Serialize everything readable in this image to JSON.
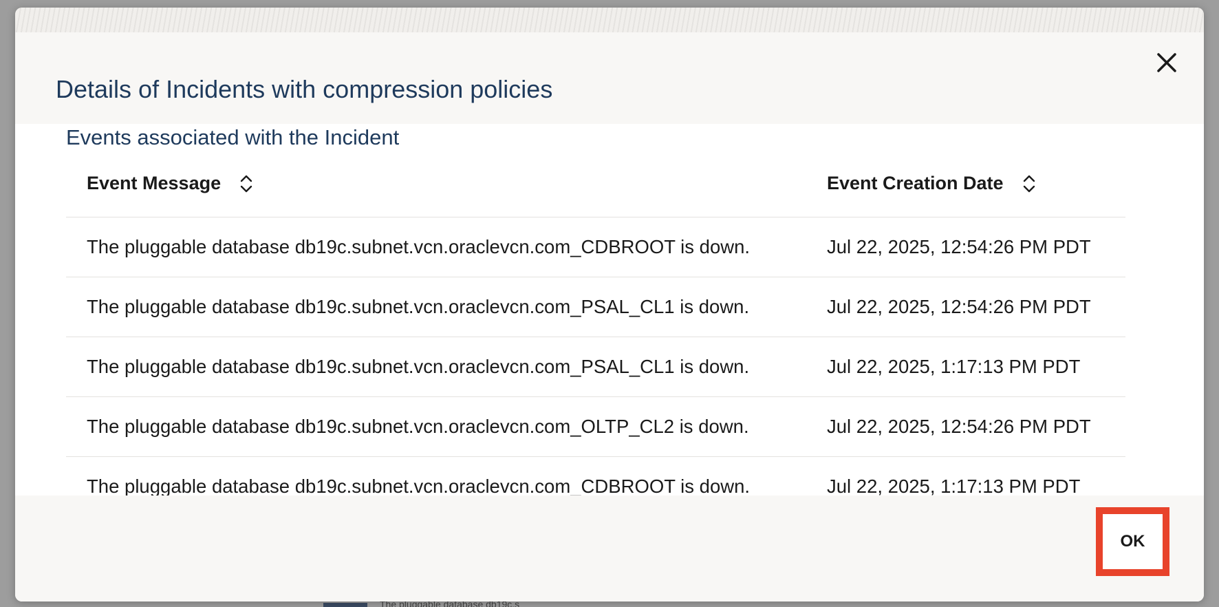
{
  "dialog": {
    "title": "Details of Incidents with compression policies",
    "close_icon": "close-icon",
    "ok_label": "OK"
  },
  "events": {
    "section_title": "Events associated with the Incident",
    "columns": [
      {
        "label": "Event Message",
        "sort_icon": "sort-updown-icon"
      },
      {
        "label": "Event Creation Date",
        "sort_icon": "sort-updown-icon"
      }
    ],
    "rows": [
      {
        "message": "The pluggable database db19c.subnet.vcn.oraclevcn.com_CDBROOT is down.",
        "date": "Jul 22, 2025, 12:54:26 PM PDT"
      },
      {
        "message": "The pluggable database db19c.subnet.vcn.oraclevcn.com_PSAL_CL1 is down.",
        "date": "Jul 22, 2025, 12:54:26 PM PDT"
      },
      {
        "message": "The pluggable database db19c.subnet.vcn.oraclevcn.com_PSAL_CL1 is down.",
        "date": "Jul 22, 2025, 1:17:13 PM PDT"
      },
      {
        "message": "The pluggable database db19c.subnet.vcn.oraclevcn.com_OLTP_CL2 is down.",
        "date": "Jul 22, 2025, 12:54:26 PM PDT"
      },
      {
        "message": "The pluggable database db19c.subnet.vcn.oraclevcn.com_CDBROOT is down.",
        "date": "Jul 22, 2025, 1:17:13 PM PDT"
      }
    ]
  },
  "background": {
    "peek_text": "The pluggable database db19c.s"
  },
  "colors": {
    "title": "#1e3a5c",
    "highlight": "#e8432b"
  }
}
